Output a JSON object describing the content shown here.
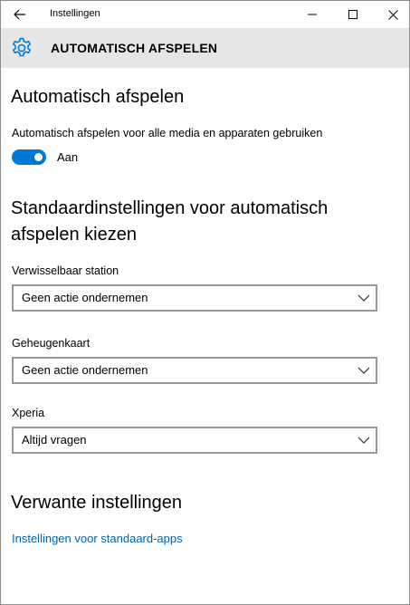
{
  "window": {
    "title": "Instellingen",
    "back_icon": "arrow-left-icon",
    "minimize_icon": "minimize-icon",
    "maximize_icon": "maximize-icon",
    "close_icon": "close-icon"
  },
  "header": {
    "icon": "gear-icon",
    "title": "AUTOMATISCH AFSPELEN"
  },
  "section_autoplay": {
    "heading": "Automatisch afspelen",
    "toggle_label": "Automatisch afspelen voor alle media en apparaten gebruiken",
    "toggle_state": "Aan",
    "toggle_on": true
  },
  "section_defaults": {
    "heading_line1": "Standaardinstellingen voor automatisch",
    "heading_line2": "afspelen kiezen",
    "dropdowns": [
      {
        "label": "Verwisselbaar station",
        "value": "Geen actie ondernemen"
      },
      {
        "label": "Geheugenkaart",
        "value": "Geen actie ondernemen"
      },
      {
        "label": "Xperia",
        "value": "Altijd vragen"
      }
    ]
  },
  "section_related": {
    "heading": "Verwante instellingen",
    "link": "Instellingen voor standaard-apps"
  },
  "colors": {
    "accent": "#0078d7",
    "link": "#0063b1",
    "header_bg": "#e6e6e6",
    "border": "#999999"
  }
}
